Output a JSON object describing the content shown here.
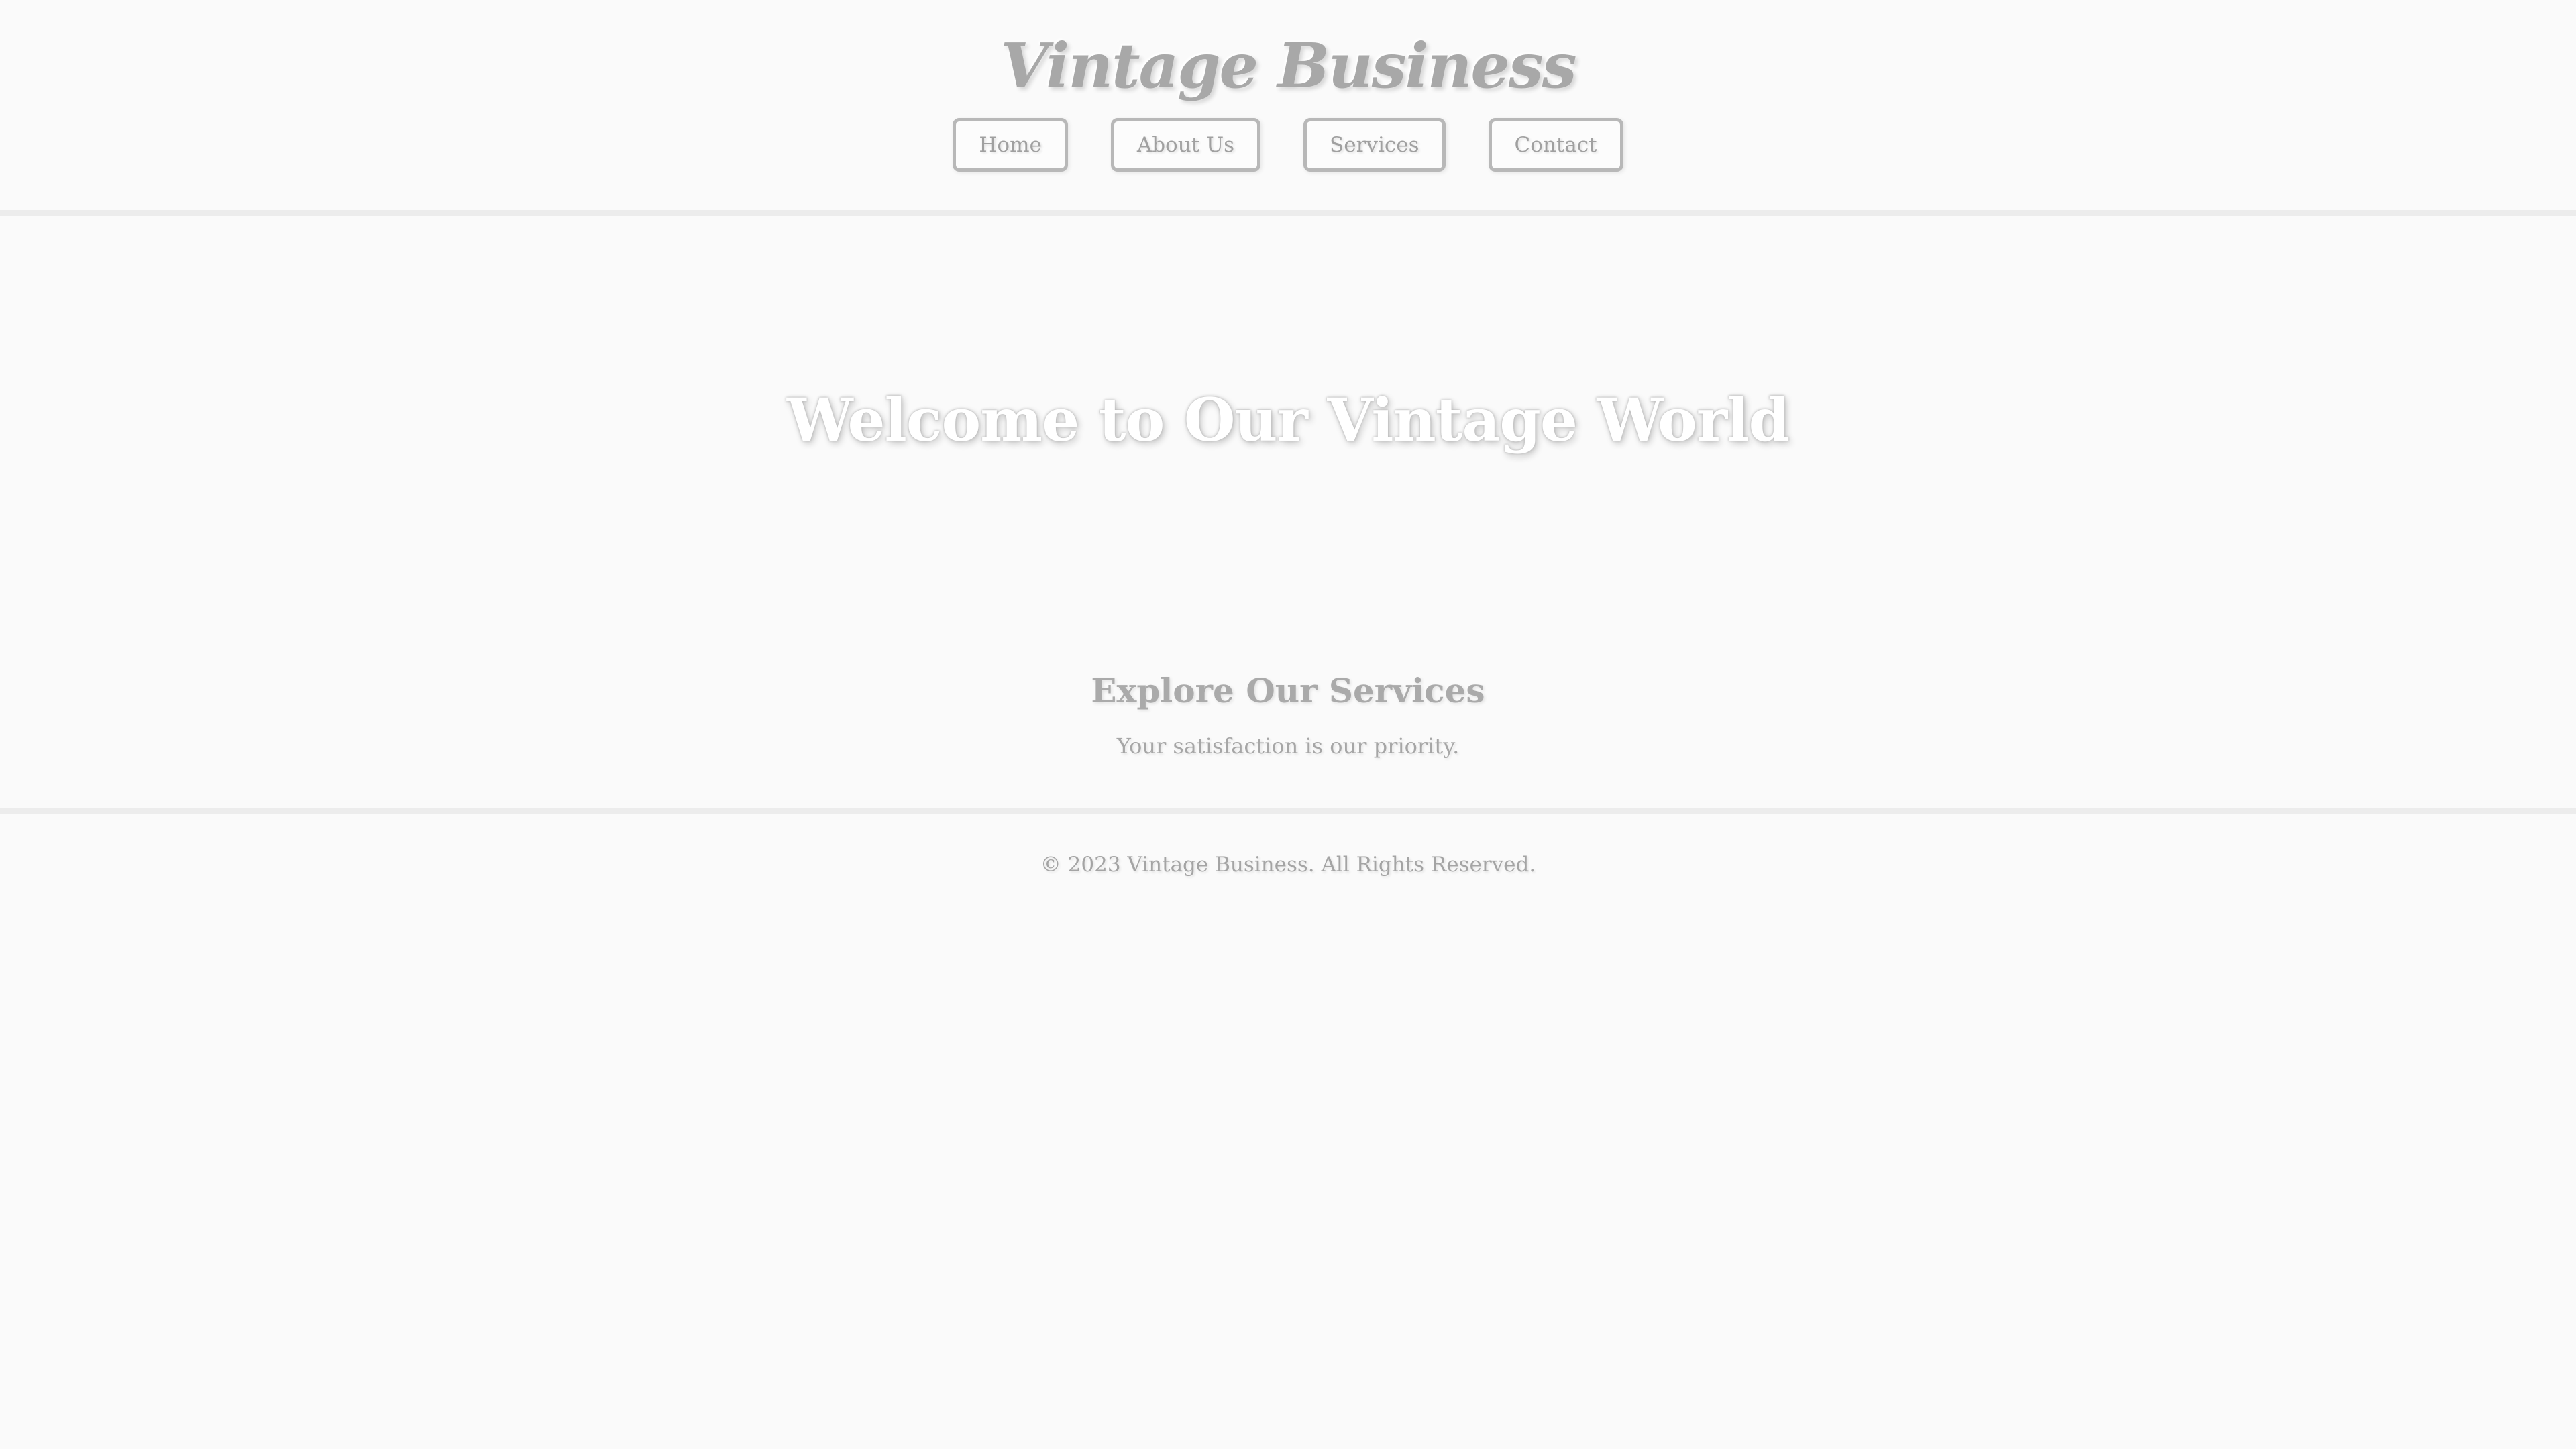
{
  "header": {
    "brand": "Vintage Business",
    "nav": [
      {
        "label": "Home"
      },
      {
        "label": "About Us"
      },
      {
        "label": "Services"
      },
      {
        "label": "Contact"
      }
    ]
  },
  "hero": {
    "title": "Welcome to Our Vintage World"
  },
  "services": {
    "title": "Explore Our Services",
    "subtitle": "Your satisfaction is our priority."
  },
  "footer": {
    "text": "© 2023 Vintage Business. All Rights Reserved."
  },
  "colors": {
    "background": "#fafafa",
    "text": "#9a9a9a",
    "border": "#b8b8b8",
    "divider": "#ececec",
    "hero_text": "#ffffff"
  }
}
